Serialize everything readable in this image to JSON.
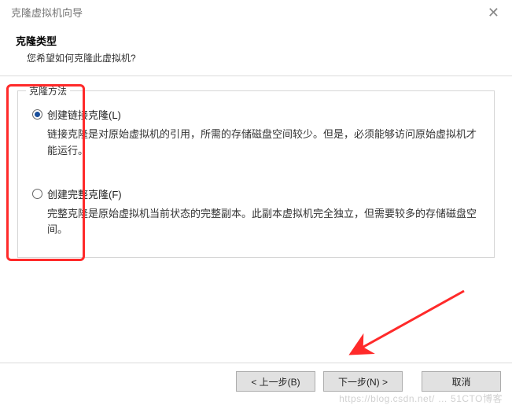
{
  "window": {
    "title": "克隆虚拟机向导"
  },
  "header": {
    "title": "克隆类型",
    "subtitle": "您希望如何克隆此虚拟机?"
  },
  "group": {
    "legend": "克隆方法",
    "options": [
      {
        "label": "创建链接克隆(L)",
        "desc": "链接克隆是对原始虚拟机的引用，所需的存储磁盘空间较少。但是，必须能够访问原始虚拟机才能运行。",
        "checked": true
      },
      {
        "label": "创建完整克隆(F)",
        "desc": "完整克隆是原始虚拟机当前状态的完整副本。此副本虚拟机完全独立，但需要较多的存储磁盘空间。",
        "checked": false
      }
    ]
  },
  "buttons": {
    "back": "< 上一步(B)",
    "next": "下一步(N) >",
    "cancel": "取消"
  },
  "watermark": "https://blog.csdn.net/ … 51CTO博客"
}
